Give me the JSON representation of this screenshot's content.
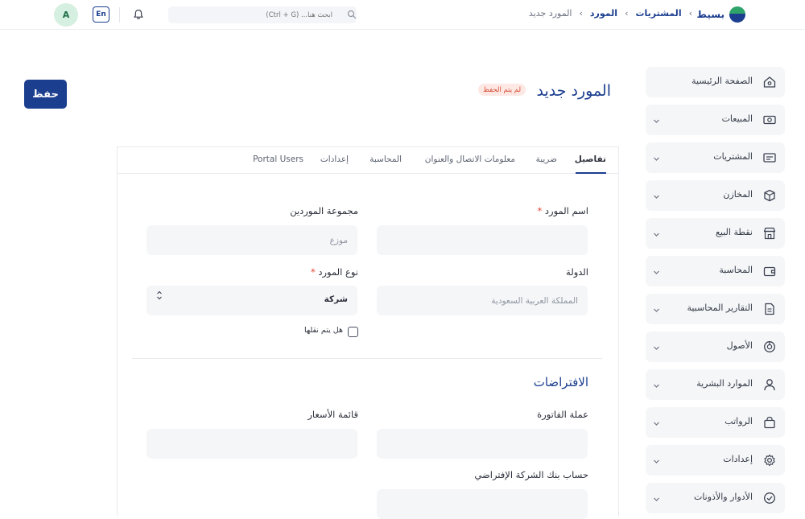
{
  "brand": {
    "name": "بسيط"
  },
  "breadcrumb": {
    "items": [
      "المشتريات",
      "المورد"
    ],
    "current": "المورد جديد"
  },
  "search": {
    "placeholder": "ابحث هنا... (Ctrl + G)"
  },
  "header": {
    "lang_label": "En",
    "avatar_initial": "A"
  },
  "sidebar": {
    "items": [
      {
        "label": "الصفحة الرئيسية",
        "icon": "home-icon",
        "expandable": false
      },
      {
        "label": "المبيعات",
        "icon": "cash-icon",
        "expandable": true
      },
      {
        "label": "المشتريات",
        "icon": "receipt-icon",
        "expandable": true
      },
      {
        "label": "المخازن",
        "icon": "box-icon",
        "expandable": true
      },
      {
        "label": "نقطة البيع",
        "icon": "store-icon",
        "expandable": true
      },
      {
        "label": "المحاسبة",
        "icon": "wallet-icon",
        "expandable": true
      },
      {
        "label": "التقارير المحاسبية",
        "icon": "report-icon",
        "expandable": true
      },
      {
        "label": "الأصول",
        "icon": "pie-chart-icon",
        "expandable": true
      },
      {
        "label": "الموارد البشرية",
        "icon": "user-icon",
        "expandable": true
      },
      {
        "label": "الرواتب",
        "icon": "bag-icon",
        "expandable": true
      },
      {
        "label": "إعدادات",
        "icon": "gear-icon",
        "expandable": true
      },
      {
        "label": "الأدوار والأذونات",
        "icon": "shield-check-icon",
        "expandable": true
      }
    ]
  },
  "page": {
    "title": "المورد جديد",
    "status_badge": "لم يتم الحفظ",
    "save_label": "حفظ"
  },
  "tabs": [
    {
      "label": "تفاصيل",
      "active": true
    },
    {
      "label": "ضريبة",
      "active": false
    },
    {
      "label": "معلومات الاتصال والعنوان",
      "active": false
    },
    {
      "label": "المحاسبة",
      "active": false
    },
    {
      "label": "إعدادات",
      "active": false
    },
    {
      "label": "Portal Users",
      "active": false
    }
  ],
  "form": {
    "supplier_name": {
      "label": "اسم المورد",
      "required": "*",
      "value": ""
    },
    "supplier_group": {
      "label": "مجموعة الموردين",
      "placeholder": "موزع"
    },
    "country": {
      "label": "الدولة",
      "placeholder": "المملكة العربية السعودية"
    },
    "supplier_type": {
      "label": "نوع المورد",
      "required": "*",
      "value": "شركة"
    },
    "is_transporter": {
      "label": "هل يتم نقلها",
      "checked": false
    },
    "defaults_title": "الافتراضات",
    "invoice_currency": {
      "label": "عملة الفاتورة",
      "value": ""
    },
    "price_list": {
      "label": "قائمة الأسعار",
      "value": ""
    },
    "default_bank_account": {
      "label": "حساب بنك الشركة الإفتراضي",
      "value": ""
    }
  },
  "colors": {
    "primary": "#1b3e8f",
    "danger": "#e0452f",
    "field_bg": "#f5f6f8",
    "sidebar_bg": "#f5f6f8"
  }
}
